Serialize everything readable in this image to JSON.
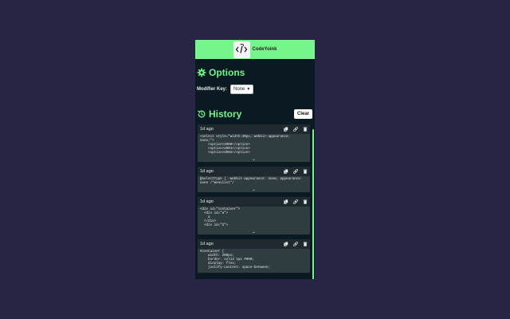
{
  "app": {
    "title": "CodeYoink"
  },
  "options": {
    "title": "Options",
    "modifier_label": "Modifier Key:",
    "modifier_value": "None"
  },
  "history": {
    "title": "History",
    "clear_label": "Clear",
    "entries": [
      {
        "time": "1d ago",
        "code": "<select style=\"width:30px;-webkit-appearance:\nnone;\">\n    <option>2000</option>\n    <option>2001</option>\n    <option>2002</option>"
      },
      {
        "time": "1d ago",
        "code": "@selectType { -webkit-appearance: none; appearance:\nnone /*menulist*/"
      },
      {
        "time": "1d ago",
        "code": "<div id=\"container\">\n  <div id=\"a\">\n    a\n  </div>\n  <div id=\"b\">"
      },
      {
        "time": "1d ago",
        "code": "#container {\n    width: 200px;\n    border: solid 1px #000;\n    display: flex;\n    justify-content: space-between;"
      }
    ]
  },
  "colors": {
    "accent": "#76f58d",
    "background": "#262543",
    "panel": "#0b1a22"
  },
  "icons": {
    "options": "gear-icon",
    "history": "history-icon",
    "copy": "copy-icon",
    "link": "link-icon",
    "delete": "trash-icon",
    "expand": "chevron-down-icon"
  }
}
